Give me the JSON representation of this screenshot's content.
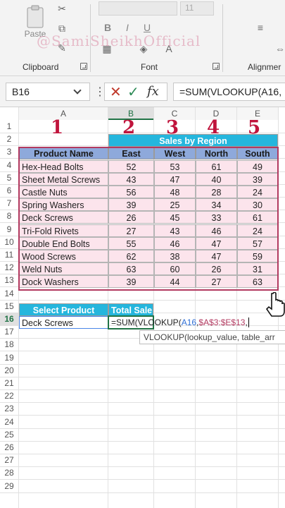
{
  "ribbon": {
    "paste_label": "Paste",
    "clipboard_label": "Clipboard",
    "font_label": "Font",
    "alignment_label": "Alignmer",
    "font_size": "11",
    "bold": "B",
    "italic": "I",
    "underline": "U",
    "watermark": "@SamiSheikhOfficial"
  },
  "formula_bar": {
    "name_box": "B16",
    "formula": "=SUM(VLOOKUP(A16,",
    "dots": "⋮",
    "cancel": "✕",
    "enter": "✓",
    "fx": "fx"
  },
  "columns": [
    "A",
    "B",
    "C",
    "D",
    "E"
  ],
  "rows": [
    "1",
    "2",
    "3",
    "4",
    "5",
    "6",
    "7",
    "8",
    "9",
    "10",
    "11",
    "12",
    "13",
    "14",
    "15",
    "16",
    "17",
    "18",
    "19",
    "20",
    "21",
    "22",
    "23",
    "24",
    "25",
    "26",
    "27",
    "28",
    "29"
  ],
  "column_numbers": [
    "1",
    "2",
    "3",
    "4",
    "5"
  ],
  "table": {
    "title": "Sales by Region",
    "headers": [
      "Product Name",
      "East",
      "West",
      "North",
      "South"
    ],
    "rows": [
      [
        "Hex-Head Bolts",
        "52",
        "53",
        "61",
        "49"
      ],
      [
        "Sheet Metal Screws",
        "43",
        "47",
        "40",
        "39"
      ],
      [
        "Castle Nuts",
        "56",
        "48",
        "28",
        "24"
      ],
      [
        "Spring Washers",
        "39",
        "25",
        "34",
        "30"
      ],
      [
        "Deck Screws",
        "26",
        "45",
        "33",
        "61"
      ],
      [
        "Tri-Fold Rivets",
        "27",
        "43",
        "46",
        "24"
      ],
      [
        "Double End Bolts",
        "55",
        "46",
        "47",
        "57"
      ],
      [
        "Wood Screws",
        "62",
        "38",
        "47",
        "59"
      ],
      [
        "Weld Nuts",
        "63",
        "60",
        "26",
        "31"
      ],
      [
        "Dock Washers",
        "39",
        "44",
        "27",
        "63"
      ]
    ]
  },
  "lookup": {
    "select_label": "Select Product",
    "total_label": "Total Sale",
    "selected_product": "Deck Screws",
    "formula_prefix": "=SUM(VLOOKUP(",
    "formula_ref": "A16",
    "formula_sep": ",",
    "formula_range": "$A$3:$E$13",
    "formula_end": ","
  },
  "tooltip": "VLOOKUP(lookup_value, table_arr",
  "colors": {
    "header_blue": "#8ea9db",
    "title_cyan": "#25b6dd",
    "row_pink": "#fce4ec",
    "number_red": "#c0143c",
    "excel_green": "#217346"
  }
}
